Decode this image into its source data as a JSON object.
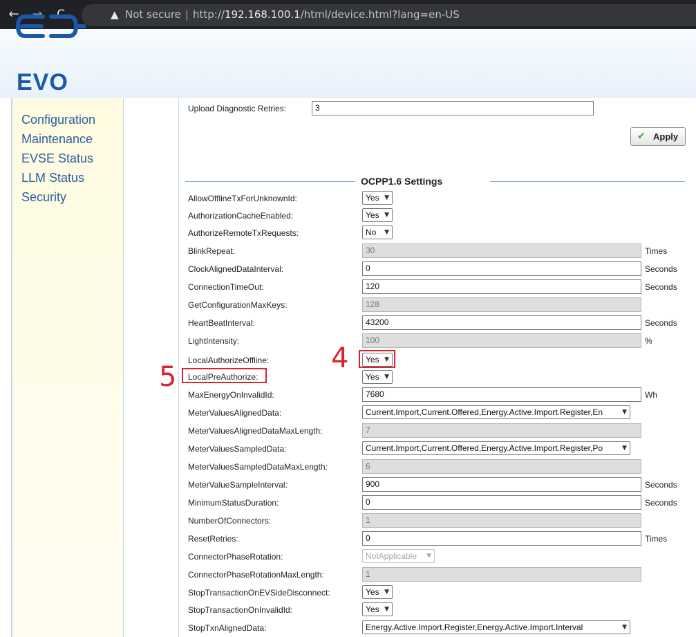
{
  "browser": {
    "back_icon": "←",
    "forward_icon": "→",
    "reload_icon": "C",
    "security_icon": "▲",
    "security_label": "Not secure",
    "url_scheme": "http://",
    "url_host": "192.168.100.1",
    "url_path": "/html/device.html?lang=en-US"
  },
  "logo": {
    "text": "EVO",
    "color": "#1b58a8"
  },
  "sidebar": {
    "items": [
      {
        "label": "Configuration"
      },
      {
        "label": "Maintenance"
      },
      {
        "label": "EVSE Status"
      },
      {
        "label": "LLM Status"
      },
      {
        "label": "Security"
      }
    ]
  },
  "upload": {
    "label": "Upload Diagnostic Retries:",
    "value": "3"
  },
  "apply": {
    "label": "Apply",
    "icon": "✔"
  },
  "section_title": "OCPP1.6 Settings",
  "annotations": {
    "four": "4",
    "five": "5",
    "color": "#d9232f"
  },
  "settings": [
    {
      "label": "AllowOfflineTxForUnknownId:",
      "value": "Yes"
    },
    {
      "label": "AuthorizationCacheEnabled:",
      "value": "Yes"
    },
    {
      "label": "AuthorizeRemoteTxRequests:",
      "value": "No"
    },
    {
      "label": "BlinkRepeat:",
      "value": "30",
      "unit": "Times"
    },
    {
      "label": "ClockAlignedDataInterval:",
      "value": "0",
      "unit": "Seconds"
    },
    {
      "label": "ConnectionTimeOut:",
      "value": "120",
      "unit": "Seconds"
    },
    {
      "label": "GetConfigurationMaxKeys:",
      "value": "128"
    },
    {
      "label": "HeartBeatInterval:",
      "value": "43200",
      "unit": "Seconds"
    },
    {
      "label": "LightIntensity:",
      "value": "100",
      "unit": "%"
    },
    {
      "label": "LocalAuthorizeOffline:",
      "value": "Yes"
    },
    {
      "label": "LocalPreAuthorize:",
      "value": "Yes"
    },
    {
      "label": "MaxEnergyOnInvalidId:",
      "value": "7680",
      "unit": "Wh"
    },
    {
      "label": "MeterValuesAlignedData:",
      "value": "Current.Import,Current.Offered,Energy.Active.Import.Register,En"
    },
    {
      "label": "MeterValuesAlignedDataMaxLength:",
      "value": "7"
    },
    {
      "label": "MeterValuesSampledData:",
      "value": "Current.Import,Current.Offered,Energy.Active.Import.Register,Po"
    },
    {
      "label": "MeterValuesSampledDataMaxLength:",
      "value": "6"
    },
    {
      "label": "MeterValueSampleInterval:",
      "value": "900",
      "unit": "Seconds"
    },
    {
      "label": "MinimumStatusDuration:",
      "value": "0",
      "unit": "Seconds"
    },
    {
      "label": "NumberOfConnectors:",
      "value": "1"
    },
    {
      "label": "ResetRetries:",
      "value": "0",
      "unit": "Times"
    },
    {
      "label": "ConnectorPhaseRotation:",
      "value": "NotApplicable"
    },
    {
      "label": "ConnectorPhaseRotationMaxLength:",
      "value": "1"
    },
    {
      "label": "StopTransactionOnEVSideDisconnect:",
      "value": "Yes"
    },
    {
      "label": "StopTransactionOnInvalidId:",
      "value": "Yes"
    },
    {
      "label": "StopTxnAlignedData:",
      "value": "Energy.Active.Import.Register,Energy.Active.Import.Interval"
    }
  ]
}
